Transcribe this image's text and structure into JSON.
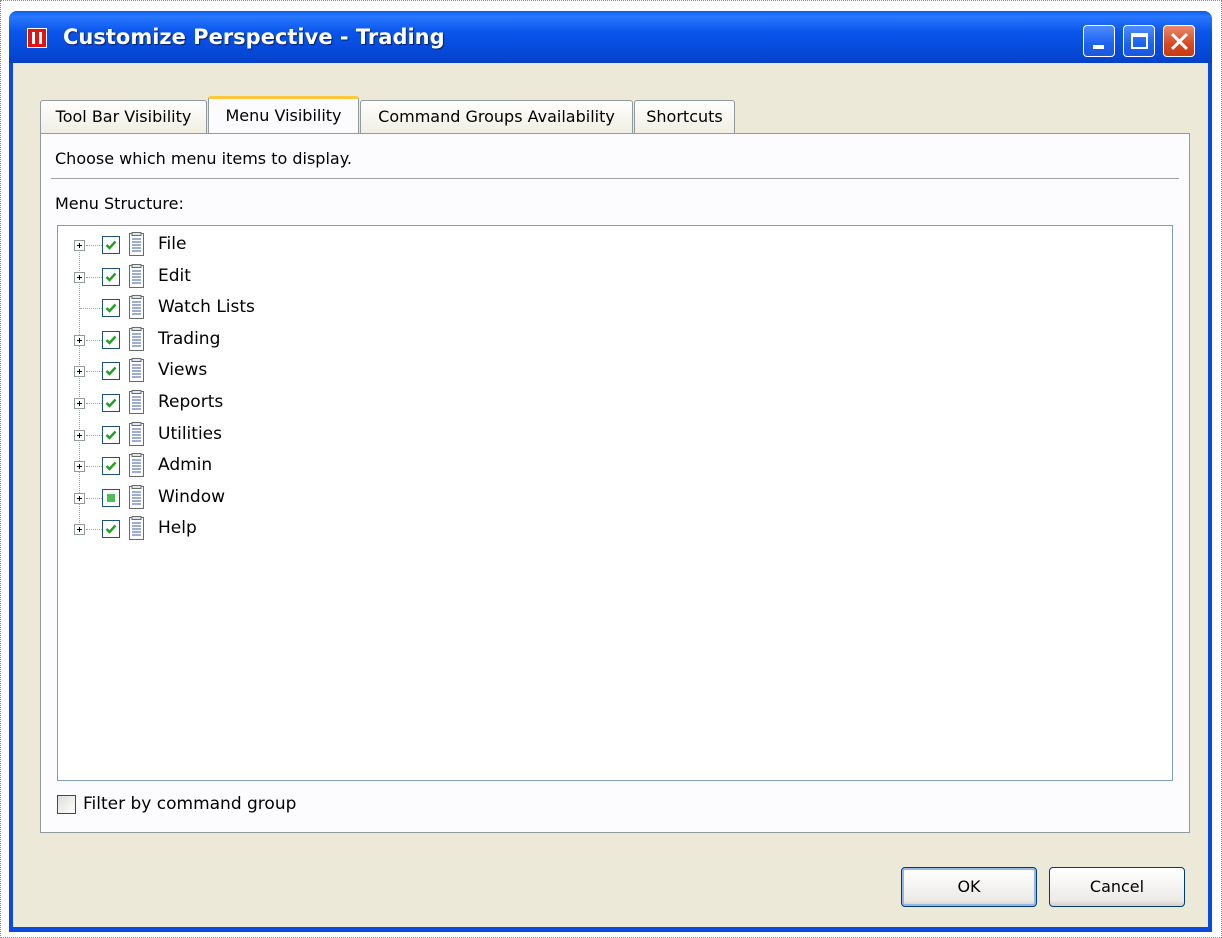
{
  "window": {
    "title": "Customize Perspective - Trading"
  },
  "tabs": [
    {
      "label": "Tool Bar Visibility",
      "active": false
    },
    {
      "label": "Menu Visibility",
      "active": true
    },
    {
      "label": "Command Groups Availability",
      "active": false
    },
    {
      "label": "Shortcuts",
      "active": false
    }
  ],
  "panel": {
    "description": "Choose which menu items to display.",
    "structure_label": "Menu Structure:",
    "tree": [
      {
        "label": "File",
        "expandable": true,
        "state": "checked"
      },
      {
        "label": "Edit",
        "expandable": true,
        "state": "checked"
      },
      {
        "label": "Watch Lists",
        "expandable": false,
        "state": "checked"
      },
      {
        "label": "Trading",
        "expandable": true,
        "state": "checked"
      },
      {
        "label": "Views",
        "expandable": true,
        "state": "checked"
      },
      {
        "label": "Reports",
        "expandable": true,
        "state": "checked"
      },
      {
        "label": "Utilities",
        "expandable": true,
        "state": "checked"
      },
      {
        "label": "Admin",
        "expandable": true,
        "state": "checked"
      },
      {
        "label": "Window",
        "expandable": true,
        "state": "partial"
      },
      {
        "label": "Help",
        "expandable": true,
        "state": "checked"
      }
    ],
    "filter_label": "Filter by command group",
    "filter_checked": false
  },
  "buttons": {
    "ok": "OK",
    "cancel": "Cancel"
  },
  "colors": {
    "titlebar": "#0a55ec",
    "dialog_bg": "#ece9d8",
    "check_green": "#21a121",
    "active_tab_accent": "#ffc73c"
  }
}
